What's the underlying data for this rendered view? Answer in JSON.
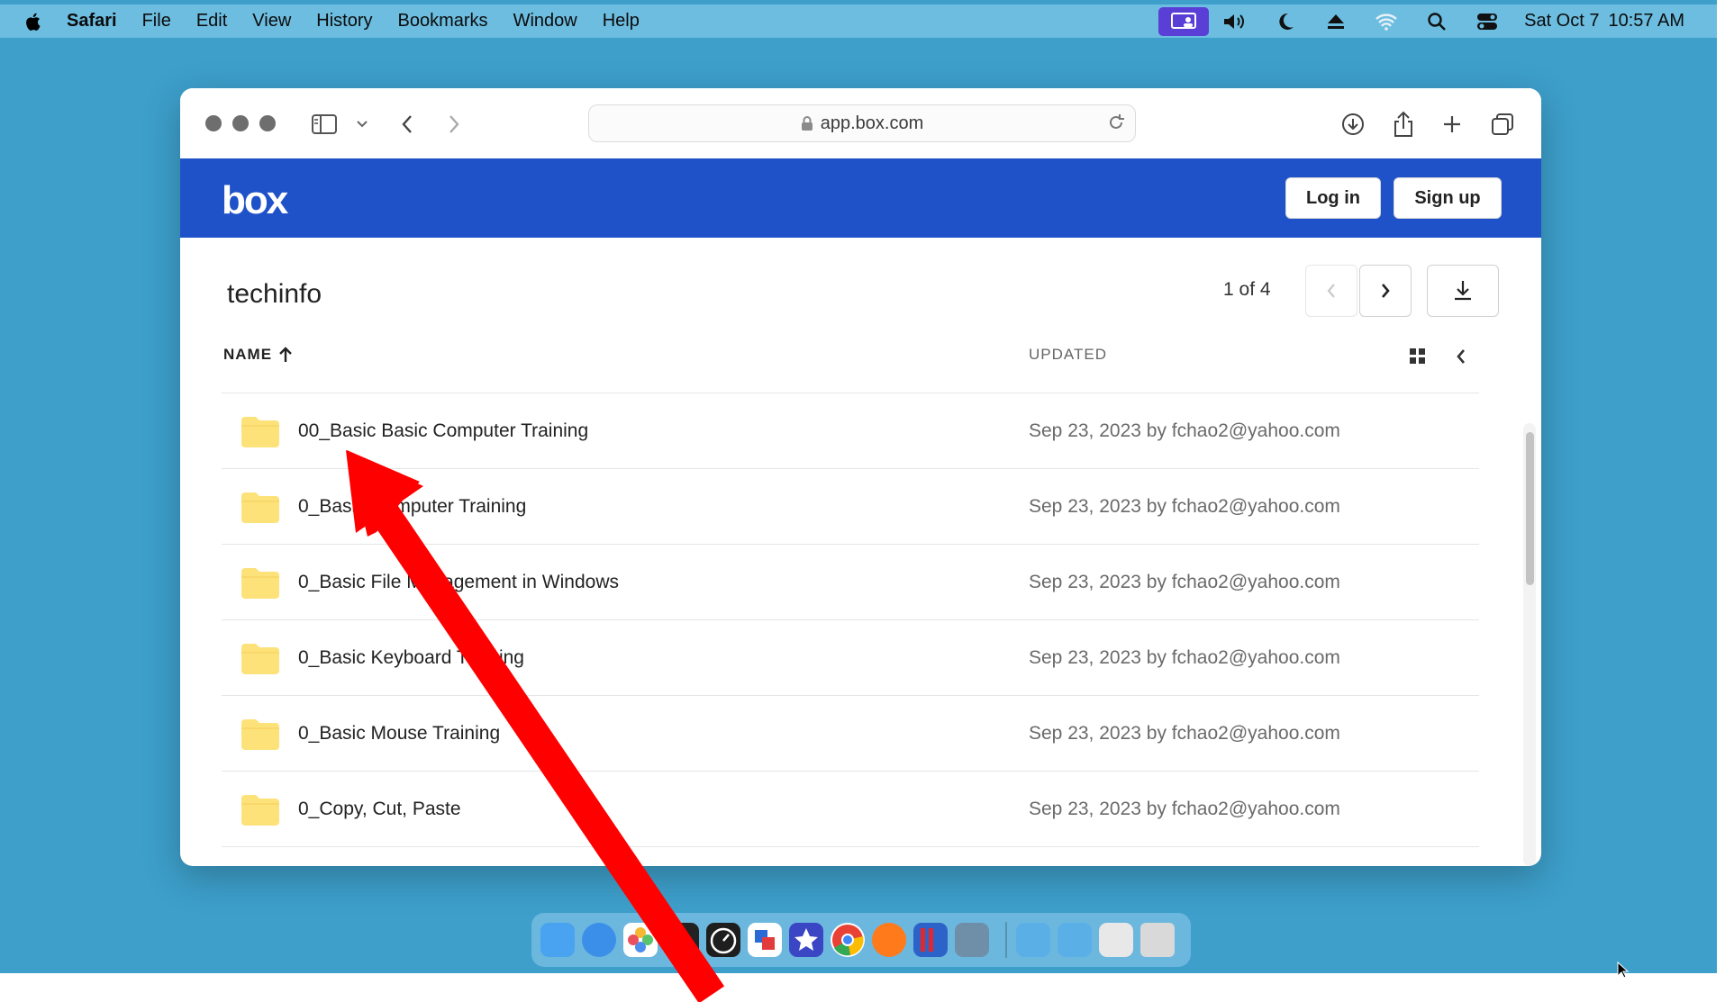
{
  "menubar": {
    "apple_icon": "apple-icon",
    "items": [
      "Safari",
      "File",
      "Edit",
      "View",
      "History",
      "Bookmarks",
      "Window",
      "Help"
    ],
    "date": "Sat Oct 7",
    "time": "10:57 AM"
  },
  "browser": {
    "url": "app.box.com"
  },
  "box_header": {
    "logo": "box",
    "login_label": "Log in",
    "signup_label": "Sign up"
  },
  "folder": {
    "title": "techinfo",
    "pager": "1 of 4"
  },
  "columns": {
    "name": "NAME",
    "updated": "UPDATED"
  },
  "rows": [
    {
      "name": "00_Basic Basic Computer Training",
      "updated": "Sep 23, 2023 by fchao2@yahoo.com"
    },
    {
      "name": "0_Basic Computer Training",
      "updated": "Sep 23, 2023 by fchao2@yahoo.com"
    },
    {
      "name": "0_Basic File Management in Windows",
      "updated": "Sep 23, 2023 by fchao2@yahoo.com"
    },
    {
      "name": "0_Basic Keyboard Training",
      "updated": "Sep 23, 2023 by fchao2@yahoo.com"
    },
    {
      "name": "0_Basic Mouse Training",
      "updated": "Sep 23, 2023 by fchao2@yahoo.com"
    },
    {
      "name": "0_Copy, Cut, Paste",
      "updated": "Sep 23, 2023 by fchao2@yahoo.com"
    }
  ],
  "colors": {
    "desktop": "#3d9fca",
    "menubar": "#6cbde0",
    "box_blue": "#1f52c9",
    "folder_yellow": "#fde27a",
    "arrow_red": "#ff0000"
  }
}
